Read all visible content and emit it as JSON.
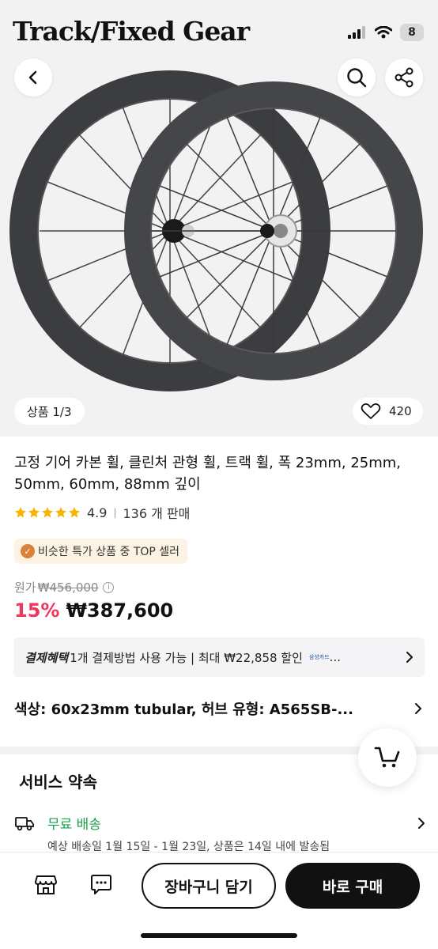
{
  "status_bar": {
    "brand_overlay": "Track/Fixed Gear",
    "battery": "8"
  },
  "hero": {
    "image_counter": "상품 1/3",
    "like_count": "420"
  },
  "product": {
    "title": "고정 기어 카본 휠, 클린처 관형 휠, 트랙 휠, 폭 23mm, 25mm, 50mm, 60mm, 88mm 깊이",
    "rating": "4.9",
    "stars": 5,
    "sales": "136 개 판매",
    "seller_badge": "비슷한 특가 상품 중 TOP 셀러",
    "original_price_label": "원가",
    "original_price": "₩456,000",
    "discount": "15%",
    "price": "₩387,600"
  },
  "benefit": {
    "title": "결제혜택",
    "text": "1개 결제방법 사용 가능 | 최대 ₩22,858 할인",
    "card": "삼성카드",
    "ellipsis": "..."
  },
  "option": {
    "text": "색상: 60x23mm tubular, 허브 유형: A565SB-..."
  },
  "service": {
    "title": "서비스 약속",
    "shipping_label": "무료 배송",
    "shipping_detail": "예상 배송일 1월 15일 - 1월 23일, 상품은 14일 내에 발송됨"
  },
  "bottom_bar": {
    "add_to_cart": "장바구니 담기",
    "buy_now": "바로 구매"
  },
  "colors": {
    "discount": "#f0375b",
    "shipping_green": "#1aa04a",
    "star": "#f6b400",
    "primary_button": "#111111"
  }
}
